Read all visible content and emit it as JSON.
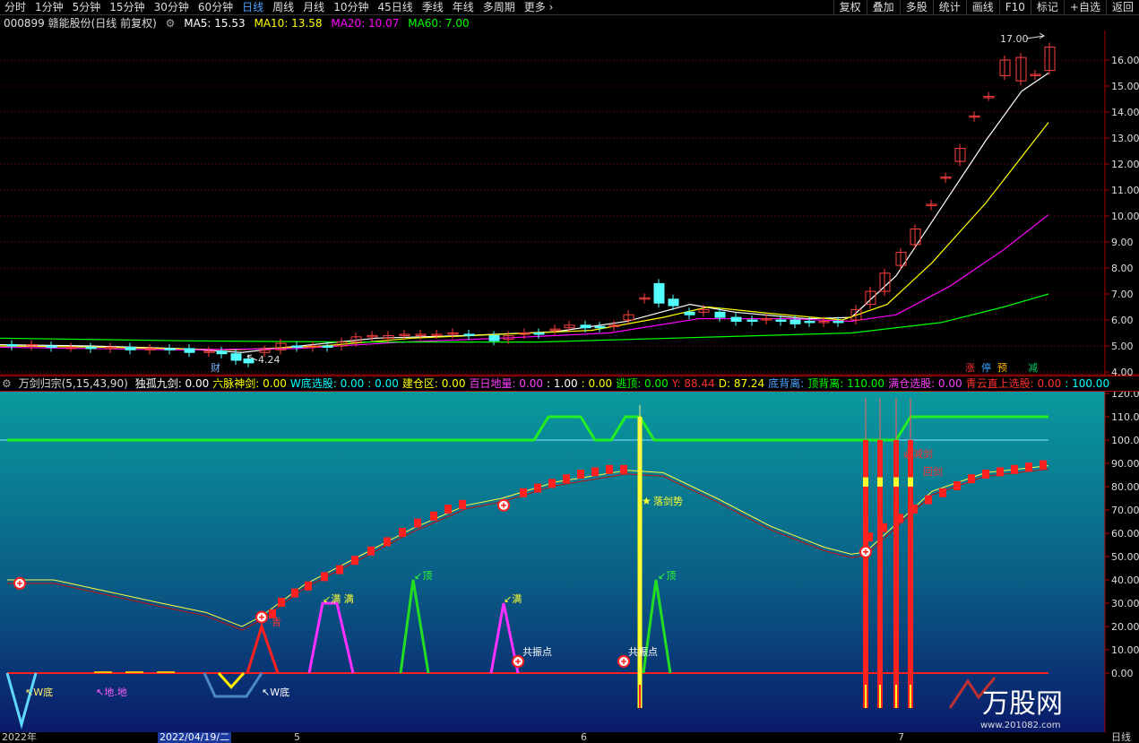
{
  "toolbar": {
    "periods": [
      "分时",
      "1分钟",
      "5分钟",
      "15分钟",
      "30分钟",
      "60分钟",
      "日线",
      "周线",
      "月线",
      "10分钟",
      "45日线",
      "季线",
      "年线",
      "多周期",
      "更多"
    ],
    "active_period": "日线",
    "right_items": [
      "复权",
      "叠加",
      "多股",
      "统计",
      "画线",
      "F10",
      "标记",
      "+自选",
      "返回"
    ]
  },
  "stock": {
    "code_name": "000899 赣能股份(日线 前复权)",
    "ma5": "MA5: 15.53",
    "ma10": "MA10: 13.58",
    "ma20": "MA20: 10.07",
    "ma60": "MA60: 7.00",
    "high_label": "17.00",
    "low_label": "4.24",
    "fin_label": "财",
    "bottom_tags": [
      "涨",
      "停",
      "预",
      "减"
    ]
  },
  "colors": {
    "up": "#ff4040",
    "down": "#54ffff",
    "ma5": "#ffffff",
    "ma10": "#ffff00",
    "ma20": "#ff00ff",
    "ma60": "#00ff00",
    "grid": "#8b0000"
  },
  "price_axis": [
    "16.00",
    "15.00",
    "14.00",
    "13.00",
    "12.00",
    "11.00",
    "10.00",
    "9.00",
    "8.00",
    "7.00",
    "6.00",
    "5.00",
    "4.00"
  ],
  "indicator": {
    "name": "万剑归宗(5,15,43,90)",
    "fields": [
      {
        "label": "独孤九剑: 0.00",
        "color": "#ffffff"
      },
      {
        "label": "六脉神剑: 0.00",
        "color": "#ffff00"
      },
      {
        "label": "W底选股: 0.00",
        "color": "#00ffff"
      },
      {
        "label": ": 0.00",
        "color": "#00ffff"
      },
      {
        "label": "建仓区: 0.00",
        "color": "#ffff00"
      },
      {
        "label": "百日地量: 0.00",
        "color": "#ff40ff"
      },
      {
        "label": ": 1.00",
        "color": "#ffffff"
      },
      {
        "label": ": 0.00",
        "color": "#ffff00"
      },
      {
        "label": "逃顶: 0.00",
        "color": "#00ff00"
      },
      {
        "label": "Y: 88.44",
        "color": "#ff3030"
      },
      {
        "label": "D: 87.24",
        "color": "#ffff00"
      },
      {
        "label": "底背离:",
        "color": "#4aa3ff"
      },
      {
        "label": "顶背离: 110.00",
        "color": "#00ff00"
      },
      {
        "label": "满仓选股: 0.00",
        "color": "#ff40ff"
      },
      {
        "label": "青云直上选股: 0.00",
        "color": "#ff3030"
      },
      {
        "label": ": 100.00",
        "color": "#00ffff"
      }
    ],
    "axis": [
      "120.00",
      "110.00",
      "100.00",
      "90.00",
      "80.00",
      "70.00",
      "60.00",
      "50.00",
      "40.00",
      "30.00",
      "20.00",
      "10.00",
      "0.00"
    ],
    "labels": {
      "w_bottom_1": "W底",
      "di_di": "地.地",
      "w_bottom_2": "W底",
      "qing": "青",
      "man_man": "满 满",
      "man": "满",
      "ding_1": "顶",
      "ding_2": "顶",
      "gongzhen_1": "共振点",
      "gongzhen_2": "共振点",
      "luojian": "落剑势",
      "bijian": "必减剑",
      "huijian": "回剑"
    }
  },
  "dates": {
    "year": "2022年",
    "selected": "2022/04/19/二",
    "m5": "5",
    "m6": "6",
    "m7": "7",
    "period": "日线"
  },
  "watermark": {
    "name": "万股网",
    "url": "www.201082.com"
  }
}
